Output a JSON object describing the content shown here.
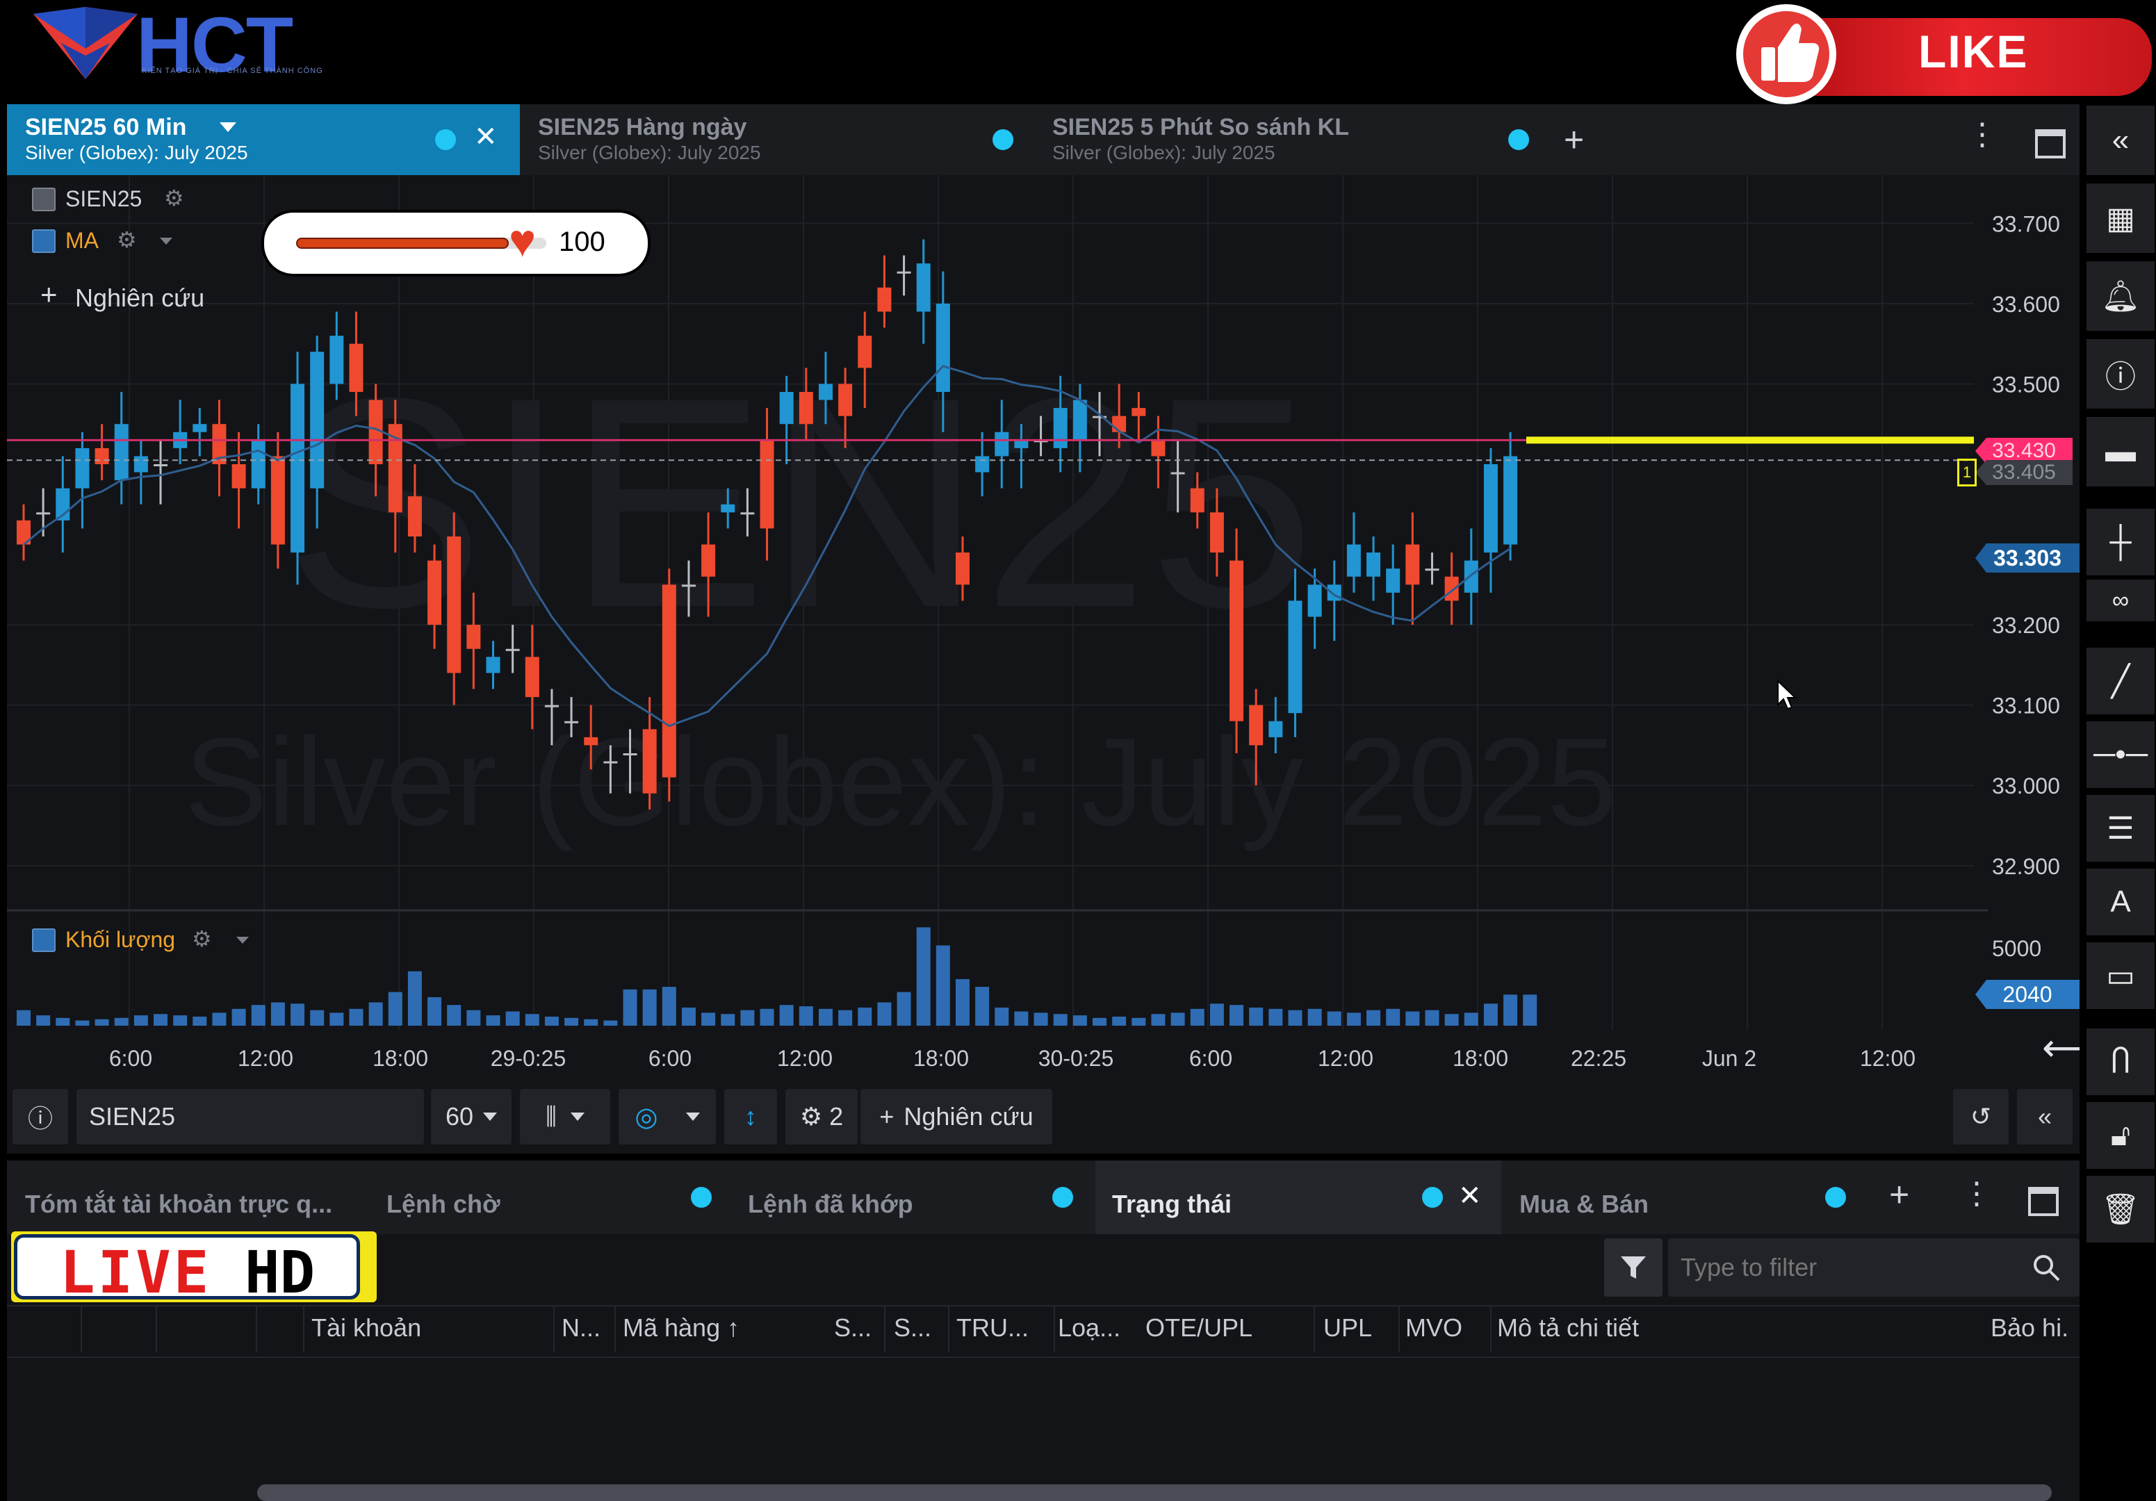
{
  "brand": {
    "logo_text": "HCT",
    "logo_tagline": "KIẾN TẠO GIÁ TRỊ - CHIA SẺ THÀNH CÔNG",
    "like_label": "LIKE",
    "live_label_1": "LIVE",
    "live_label_2": "HD"
  },
  "chart_tabs": [
    {
      "title": "SIEN25 60 Min",
      "subtitle": "Silver (Globex): July 2025",
      "active": true
    },
    {
      "title": "SIEN25 Hàng ngày",
      "subtitle": "Silver (Globex): July 2025",
      "active": false
    },
    {
      "title": "SIEN25 5 Phút So sánh KL",
      "subtitle": "Silver (Globex): July 2025",
      "active": false
    }
  ],
  "legend": {
    "symbol": "SIEN25",
    "ma": "MA",
    "research": "Nghiên cứu",
    "volume": "Khối lượng"
  },
  "heart_slider": {
    "value": "100",
    "fraction": 0.85
  },
  "watermark": {
    "symbol": "SIEN25",
    "description": "Silver (Globex): July 2025"
  },
  "price_axis": {
    "ticks": [
      "33.700",
      "33.600",
      "33.500",
      "33.200",
      "33.100",
      "33.000",
      "32.900"
    ],
    "tick_values": [
      33.7,
      33.6,
      33.5,
      33.2,
      33.1,
      33.0,
      32.9
    ],
    "alert_price": "33.430",
    "dashed_price": "33.405",
    "last_price": "33.303",
    "volume_tick": "5000",
    "volume_last": "2040",
    "alert_marker": "1"
  },
  "time_axis": [
    "6:00",
    "12:00",
    "18:00",
    "29-0:25",
    "6:00",
    "12:00",
    "18:00",
    "30-0:25",
    "6:00",
    "12:00",
    "18:00",
    "22:25",
    "Jun 2",
    "12:00"
  ],
  "chart_data": {
    "type": "candlestick",
    "symbol": "SIEN25",
    "interval": "60 Min",
    "ylim": [
      32.86,
      33.76
    ],
    "open": [
      33.33,
      33.34,
      33.33,
      33.37,
      33.42,
      33.38,
      33.39,
      33.4,
      33.42,
      33.44,
      33.45,
      33.4,
      33.37,
      33.41,
      33.29,
      33.37,
      33.5,
      33.55,
      33.48,
      33.45,
      33.36,
      33.28,
      33.31,
      33.2,
      33.14,
      33.17,
      33.16,
      33.1,
      33.08,
      33.06,
      33.03,
      33.04,
      33.07,
      33.25,
      33.25,
      33.3,
      33.34,
      33.34,
      33.43,
      33.45,
      33.49,
      33.48,
      33.5,
      33.56,
      33.62,
      33.64,
      33.59,
      33.49,
      33.29,
      33.39,
      33.41,
      33.42,
      33.43,
      33.42,
      33.43,
      33.46,
      33.46,
      33.47,
      33.43,
      33.39,
      33.37,
      33.34,
      33.28,
      33.1,
      33.06,
      33.09,
      33.21,
      33.23,
      33.26,
      33.26,
      33.24,
      33.3,
      33.27,
      33.26,
      33.24,
      33.29,
      33.3
    ],
    "close": [
      33.3,
      33.34,
      33.37,
      33.42,
      33.4,
      33.45,
      33.41,
      33.4,
      33.44,
      33.45,
      33.4,
      33.37,
      33.43,
      33.3,
      33.5,
      33.54,
      33.56,
      33.49,
      33.4,
      33.34,
      33.31,
      33.2,
      33.14,
      33.17,
      33.16,
      33.17,
      33.11,
      33.1,
      33.08,
      33.05,
      33.03,
      33.04,
      32.99,
      33.01,
      33.25,
      33.26,
      33.35,
      33.34,
      33.32,
      33.49,
      33.45,
      33.5,
      33.46,
      33.52,
      33.59,
      33.64,
      33.65,
      33.6,
      33.25,
      33.41,
      33.44,
      33.43,
      33.43,
      33.47,
      33.48,
      33.46,
      33.44,
      33.46,
      33.41,
      33.39,
      33.34,
      33.29,
      33.08,
      33.05,
      33.08,
      33.23,
      33.25,
      33.25,
      33.3,
      33.29,
      33.27,
      33.25,
      33.27,
      33.23,
      33.28,
      33.4,
      33.41
    ],
    "volume": [
      600,
      400,
      300,
      200,
      250,
      300,
      400,
      450,
      400,
      350,
      500,
      650,
      800,
      900,
      850,
      600,
      500,
      650,
      900,
      1300,
      2100,
      1100,
      800,
      600,
      400,
      550,
      450,
      350,
      300,
      250,
      200,
      1400,
      1400,
      1500,
      700,
      500,
      450,
      600,
      650,
      800,
      750,
      650,
      600,
      700,
      900,
      1300,
      3800,
      3100,
      1800,
      1500,
      700,
      550,
      500,
      450,
      400,
      300,
      350,
      300,
      450,
      500,
      650,
      850,
      800,
      700,
      650,
      600,
      650,
      550,
      500,
      600,
      650,
      550,
      600,
      450,
      500,
      850,
      1200,
      1200
    ],
    "ma_note": "moving average line drawn",
    "alert_price": 33.43,
    "last_price": 33.303
  },
  "chart_toolbar": {
    "symbol_input": "SIEN25",
    "interval": "60",
    "indicator_count": "2",
    "research": "Nghiên cứu"
  },
  "bottom_tabs": [
    {
      "label": "Tóm tắt tài khoản trực q...",
      "active": false
    },
    {
      "label": "Lệnh chờ",
      "active": false
    },
    {
      "label": "Lệnh đã khớp",
      "active": false
    },
    {
      "label": "Trạng thái",
      "active": true
    },
    {
      "label": "Mua & Bán",
      "active": false
    }
  ],
  "filter": {
    "placeholder": "Type to filter"
  },
  "columns": [
    "Tài khoản",
    "N...",
    "Mã hàng",
    "S...",
    "S...",
    "TRU...",
    "Loạ...",
    "OTE/UPL",
    "UPL",
    "MVO",
    "Mô tả chi tiết",
    "Bảo hi."
  ],
  "colors": {
    "up": "#2196d3",
    "down": "#ef4a2f",
    "alert": "#ff2d6f",
    "accent": "#21c7f5",
    "active_tab": "#0f7fb5",
    "yellow": "#f2f21a"
  }
}
